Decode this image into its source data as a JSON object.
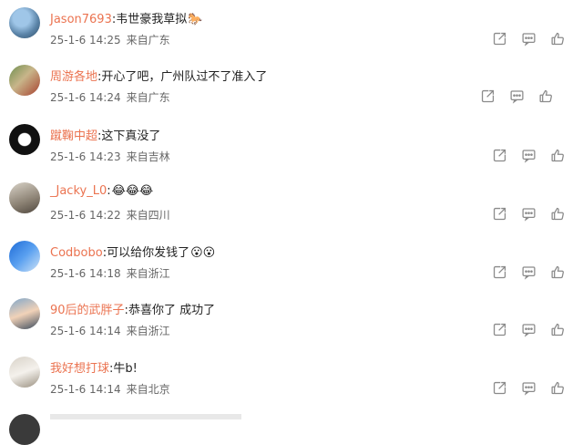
{
  "comments": [
    {
      "user": "Jason7693",
      "text": "韦世豪我草拟",
      "emoji": "🐎",
      "date": "25-1-6 14:25",
      "location": "来自广东"
    },
    {
      "user": "周游各地",
      "text": "开心了吧，广州队过不了准入了",
      "emoji": "",
      "date": "25-1-6 14:24",
      "location": "来自广东"
    },
    {
      "user": "蹴鞠中超",
      "text": "这下真没了",
      "emoji": "",
      "date": "25-1-6 14:23",
      "location": "来自吉林"
    },
    {
      "user": "_Jacky_L0",
      "text": "",
      "emoji": "😂😂😂",
      "date": "25-1-6 14:22",
      "location": "来自四川"
    },
    {
      "user": "Codbobo",
      "text": "可以给你发钱了",
      "emoji": "😮😮",
      "date": "25-1-6 14:18",
      "location": "来自浙江"
    },
    {
      "user": "90后的武胖子",
      "text": "恭喜你了  成功了",
      "emoji": "",
      "date": "25-1-6 14:14",
      "location": "来自浙江"
    },
    {
      "user": "我好想打球",
      "text": "牛b!",
      "emoji": "",
      "date": "25-1-6 14:14",
      "location": "来自北京"
    }
  ],
  "icons": {
    "share": "share-icon",
    "comment": "comment-icon",
    "like": "thumbs-up-icon"
  },
  "colors": {
    "username": "#eb7350",
    "meta": "#666666",
    "text": "#222222",
    "icon": "#8a8a8a"
  }
}
